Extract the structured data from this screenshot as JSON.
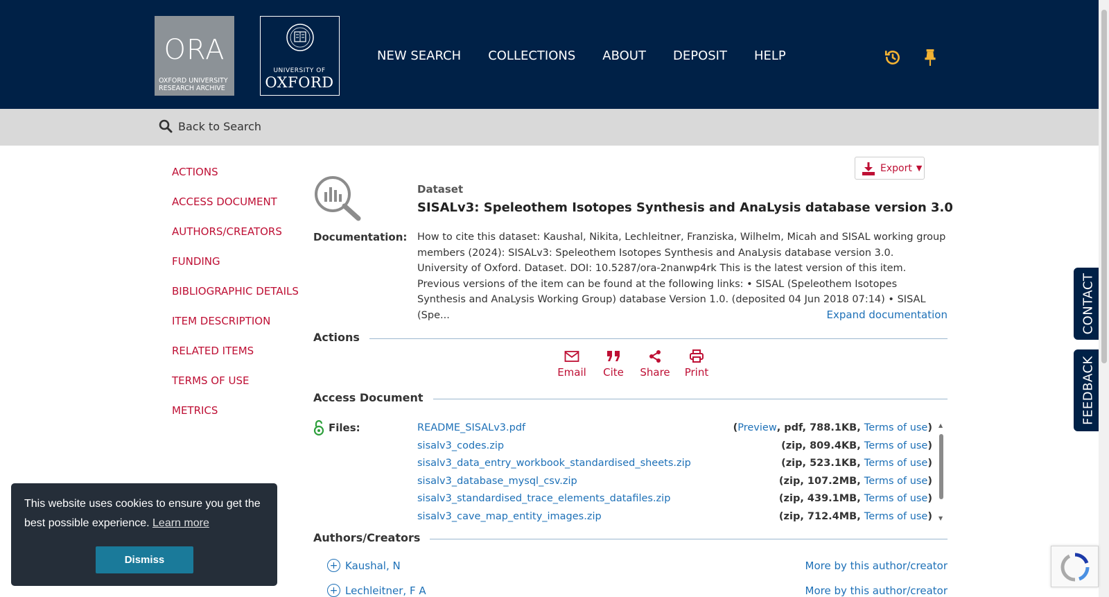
{
  "header": {
    "ora_logo": {
      "big": "ORA",
      "line1": "OXFORD UNIVERSITY",
      "line2": "RESEARCH ARCHIVE"
    },
    "oxford_logo": {
      "line1": "UNIVERSITY OF",
      "line2": "OXFORD"
    },
    "nav": [
      "NEW SEARCH",
      "COLLECTIONS",
      "ABOUT",
      "DEPOSIT",
      "HELP"
    ],
    "icons": [
      "history-icon",
      "pin-icon"
    ],
    "icon_color": "#f2b233",
    "background": "#002147"
  },
  "back_bar": {
    "label": "Back to Search"
  },
  "sidebar": {
    "items": [
      "ACTIONS",
      "ACCESS DOCUMENT",
      "AUTHORS/CREATORS",
      "FUNDING",
      "BIBLIOGRAPHIC DETAILS",
      "ITEM DESCRIPTION",
      "RELATED ITEMS",
      "TERMS OF USE",
      "METRICS"
    ]
  },
  "record": {
    "export_label": "Export",
    "kind": "Dataset",
    "title": "SISALv3: Speleothem Isotopes Synthesis and AnaLysis database version 3.0",
    "documentation_label": "Documentation:",
    "documentation": "How to cite this dataset: Kaushal, Nikita, Lechleitner, Franziska, Wilhelm, Micah and SISAL working group members (2024): SISALv3: Speleothem Isotopes Synthesis and AnaLysis database version 3.0. University of Oxford. Dataset. DOI: 10.5287/ora-2nanwp4rk This is the latest version of this item. Previous versions of the item can be found at the following links: • SISAL (Speleothem Isotopes Synthesis and AnaLysis Working Group) database Version 1.0. (deposited 04 Jun 2018 07:14) • SISAL (Spe...",
    "expand_label": "Expand documentation"
  },
  "sections": {
    "actions": "Actions",
    "access": "Access Document",
    "authors": "Authors/Creators"
  },
  "actions": [
    {
      "label": "Email",
      "icon": "email-icon"
    },
    {
      "label": "Cite",
      "icon": "quote-icon"
    },
    {
      "label": "Share",
      "icon": "share-icon"
    },
    {
      "label": "Print",
      "icon": "print-icon"
    }
  ],
  "files": {
    "label": "Files:",
    "items": [
      {
        "name": "README_SISALv3.pdf",
        "open": "(",
        "preview": "Preview",
        "meta": ", pdf, 788.1KB, ",
        "terms": "Terms of use",
        "close": ")"
      },
      {
        "name": "sisalv3_codes.zip",
        "open": "(",
        "preview": "",
        "meta": "zip, 809.4KB, ",
        "terms": "Terms of use",
        "close": ")"
      },
      {
        "name": "sisalv3_data_entry_workbook_standardised_sheets.zip",
        "open": "(",
        "preview": "",
        "meta": "zip, 523.1KB, ",
        "terms": "Terms of use",
        "close": ")"
      },
      {
        "name": "sisalv3_database_mysql_csv.zip",
        "open": "(",
        "preview": "",
        "meta": "zip, 107.2MB, ",
        "terms": "Terms of use",
        "close": ")"
      },
      {
        "name": "sisalv3_standardised_trace_elements_datafiles.zip",
        "open": "(",
        "preview": "",
        "meta": "zip, 439.1MB, ",
        "terms": "Terms of use",
        "close": ")"
      },
      {
        "name": "sisalv3_cave_map_entity_images.zip",
        "open": "(",
        "preview": "",
        "meta": "zip, 712.4MB, ",
        "terms": "Terms of use",
        "close": ")"
      }
    ]
  },
  "authors": [
    {
      "name": "Kaushal, N",
      "more": "More by this author/creator"
    },
    {
      "name": "Lechleitner, F A",
      "more": "More by this author/creator"
    }
  ],
  "side_tabs": [
    "CONTACT",
    "FEEDBACK"
  ],
  "cookie": {
    "message": "This website uses cookies to ensure you get the best possible experience.",
    "learn_more": "Learn more",
    "dismiss": "Dismiss"
  },
  "colors": {
    "link": "#1d70b7",
    "accent": "#be0f34",
    "navy": "#002147"
  }
}
